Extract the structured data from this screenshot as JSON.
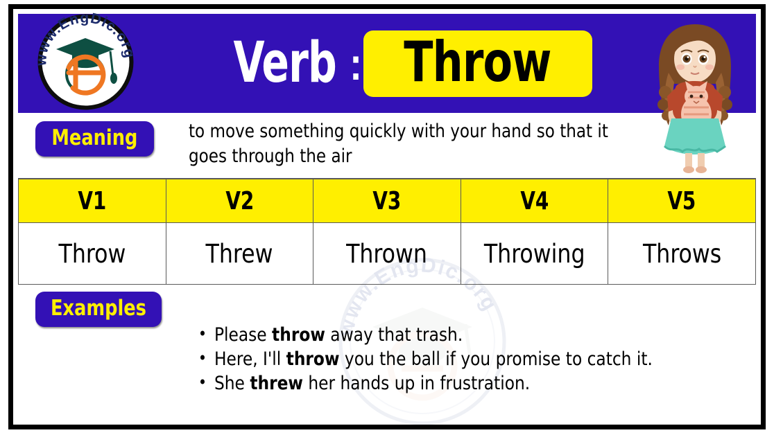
{
  "brand": {
    "logo_text": "www.EngDic.org",
    "logo_letter": "e",
    "watermark_text": "www.EngDic.org"
  },
  "header": {
    "label": "Verb",
    "separator": ":",
    "verb": "Throw",
    "background_color": "#3311b5",
    "badge_color": "#ffef00",
    "illustration": "girl-holding-cat-illustration"
  },
  "meaning": {
    "badge_label": "Meaning",
    "text": "to move something quickly with your hand so that it goes through the air"
  },
  "verb_table": {
    "headers": [
      "V1",
      "V2",
      "V3",
      "V4",
      "V5"
    ],
    "forms": [
      "Throw",
      "Threw",
      "Thrown",
      "Throwing",
      "Throws"
    ]
  },
  "examples": {
    "badge_label": "Examples",
    "items": [
      {
        "before": "Please ",
        "bold": "throw",
        "after": " away that trash."
      },
      {
        "before": "Here, I'll ",
        "bold": "throw",
        "after": " you the ball if you promise to catch it."
      },
      {
        "before": "She ",
        "bold": "threw",
        "after": " her hands up in frustration."
      }
    ]
  },
  "colors": {
    "accent_blue": "#3311b5",
    "accent_yellow": "#ffef00",
    "frame_black": "#000000",
    "grid_gray": "#595959"
  }
}
